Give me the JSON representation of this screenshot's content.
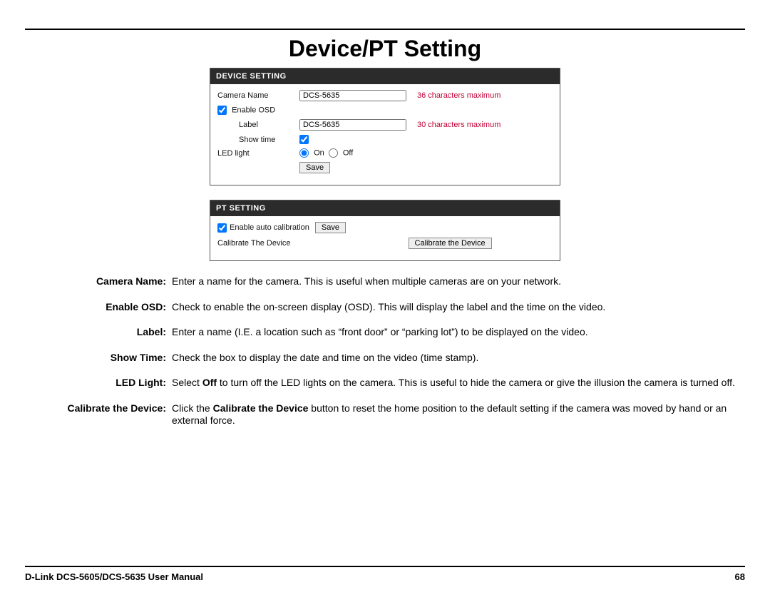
{
  "page_title": "Device/PT Setting",
  "device_panel": {
    "header": "DEVICE SETTING",
    "camera_name_label": "Camera Name",
    "camera_name_value": "DCS-5635",
    "camera_name_hint": "36 characters maximum",
    "enable_osd_label": "Enable OSD",
    "osd_label_label": "Label",
    "osd_label_value": "DCS-5635",
    "osd_label_hint": "30 characters maximum",
    "show_time_label": "Show time",
    "led_light_label": "LED light",
    "led_on_label": "On",
    "led_off_label": "Off",
    "save_label": "Save"
  },
  "pt_panel": {
    "header": "PT SETTING",
    "enable_auto_label": "Enable auto calibration",
    "save_label": "Save",
    "calibrate_label": "Calibrate The Device",
    "calibrate_button": "Calibrate the Device"
  },
  "definitions": [
    {
      "term": "Camera Name:",
      "desc_html": "Enter a name for the camera. This is useful when multiple cameras are on your network."
    },
    {
      "term": "Enable OSD:",
      "desc_html": "Check to enable the on-screen display (OSD). This will display the label and the time on the video."
    },
    {
      "term": "Label:",
      "desc_html": "Enter a name (I.E. a location such as “front door” or “parking lot”) to be displayed on the video."
    },
    {
      "term": "Show Time:",
      "desc_html": "Check the box to display the date and time on the video (time stamp)."
    },
    {
      "term": "LED Light:",
      "desc_html": "Select <b>Off</b> to turn off the LED lights on the camera. This is useful to hide the camera or give the illusion the camera is turned off."
    },
    {
      "term": "Calibrate the Device:",
      "desc_html": "Click the <b>Calibrate the Device</b> button to reset the home position to the default setting if the camera was moved by hand or an external force."
    }
  ],
  "footer": {
    "left": "D-Link DCS-5605/DCS-5635 User Manual",
    "right": "68"
  }
}
